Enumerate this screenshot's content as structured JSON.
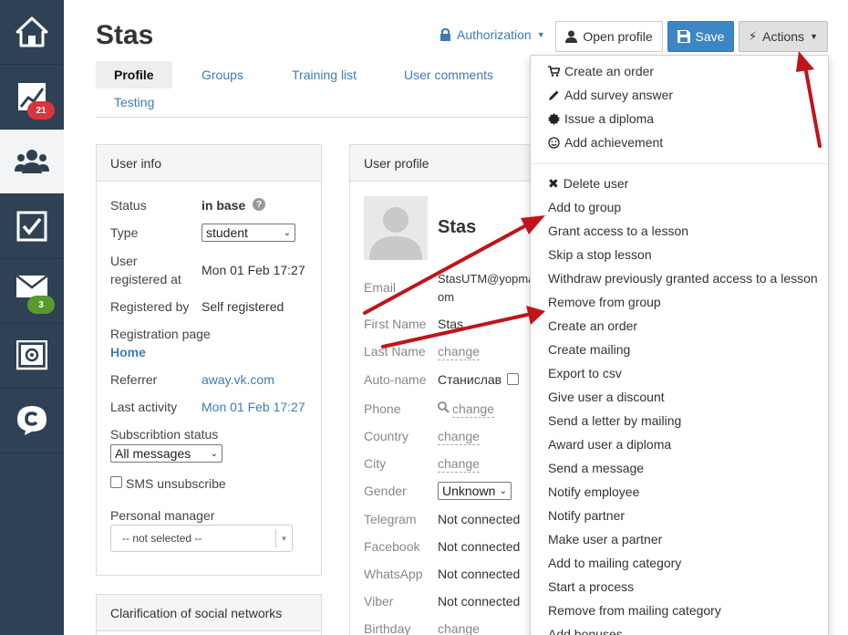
{
  "sidebar": {
    "items": [
      {
        "name": "home",
        "icon": "home-icon"
      },
      {
        "name": "stats",
        "icon": "chart-icon",
        "badge": "21",
        "badge_color": "#d9353c"
      },
      {
        "name": "users",
        "icon": "users-icon",
        "active": true
      },
      {
        "name": "tasks",
        "icon": "checkbox-icon"
      },
      {
        "name": "messages",
        "icon": "mail-icon",
        "badge": "3",
        "badge_color": "#5a9a2c"
      },
      {
        "name": "settings",
        "icon": "safe-icon"
      },
      {
        "name": "logo",
        "icon": "c-logo-icon"
      }
    ]
  },
  "header": {
    "title": "Stas",
    "authorization_label": "Authorization",
    "open_profile_label": "Open profile",
    "save_label": "Save",
    "actions_label": "Actions"
  },
  "tabs": {
    "profile": "Profile",
    "groups": "Groups",
    "training_list": "Training list",
    "user_comments": "User comments",
    "testing": "Testing"
  },
  "user_info": {
    "title": "User info",
    "status_label": "Status",
    "status_value": "in base",
    "type_label": "Type",
    "type_value": "student",
    "registered_label_1": "User",
    "registered_label_2": "registered at",
    "registered_value": "Mon 01 Feb 17:27",
    "registered_by_label": "Registered by",
    "registered_by_value": "Self registered",
    "registration_page_label": "Registration page",
    "registration_page_value": "Home",
    "referrer_label": "Referrer",
    "referrer_value": "away.vk.com",
    "last_activity_label": "Last activity",
    "last_activity_value": "Mon 01 Feb 17:27",
    "subscription_label": "Subscribtion status",
    "subscription_value": "All messages",
    "sms_label": "SMS unsubscribe",
    "manager_label": "Personal manager",
    "manager_value": "-- not selected --"
  },
  "social": {
    "title": "Clarification of social networks"
  },
  "user_profile": {
    "title": "User profile",
    "name": "Stas",
    "email_label": "Email",
    "email_value_1": "StasUTM@yopma",
    "email_value_2": "om",
    "first_name_label": "First Name",
    "first_name_value": "Stas",
    "last_name_label": "Last Name",
    "change": "change",
    "auto_name_label": "Auto-name",
    "auto_name_value": "Станислав",
    "phone_label": "Phone",
    "country_label": "Country",
    "city_label": "City",
    "gender_label": "Gender",
    "gender_value": "Unknown",
    "telegram_label": "Telegram",
    "facebook_label": "Facebook",
    "whatsapp_label": "WhatsApp",
    "viber_label": "Viber",
    "birthday_label": "Birthday",
    "not_connected": "Not connected"
  },
  "actions_menu": {
    "top_items": [
      "Create an order",
      "Add survey answer",
      "Issue a diploma",
      "Add achievement"
    ],
    "items": [
      "Delete user",
      "Add to group",
      "Grant access to a lesson",
      "Skip a stop lesson",
      "Withdraw previously granted access to a lesson",
      "Remove from group",
      "Create an order",
      "Create mailing",
      "Export to csv",
      "Give user a discount",
      "Send a letter by mailing",
      "Award user a diploma",
      "Send a message",
      "Notify employee",
      "Notify partner",
      "Make user a partner",
      "Add to mailing category",
      "Start a process",
      "Remove from mailing category",
      "Add bonuses"
    ]
  },
  "colors": {
    "sidebar": "#2f4154",
    "link": "#3f7bb5",
    "save_button": "#3d86c6",
    "annotation_arrow": "#c0141b"
  }
}
